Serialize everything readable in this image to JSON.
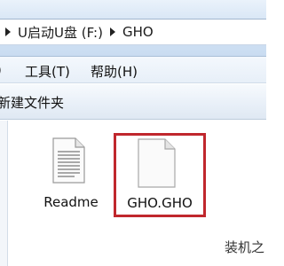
{
  "address": {
    "path": [
      "U启动U盘 (F:)",
      "GHO"
    ],
    "arrow_icon": "chevron-right-icon"
  },
  "menu": {
    "items": [
      "工具(T)",
      "帮助(H)"
    ]
  },
  "toolbar": {
    "new_folder_label": "新建文件夹"
  },
  "files": [
    {
      "name": "Readme",
      "icon": "text-document-icon",
      "selected": false
    },
    {
      "name": "GHO.GHO",
      "icon": "blank-file-icon",
      "selected": true
    }
  ],
  "highlight_color": "#c0272d",
  "watermark": "装机之"
}
